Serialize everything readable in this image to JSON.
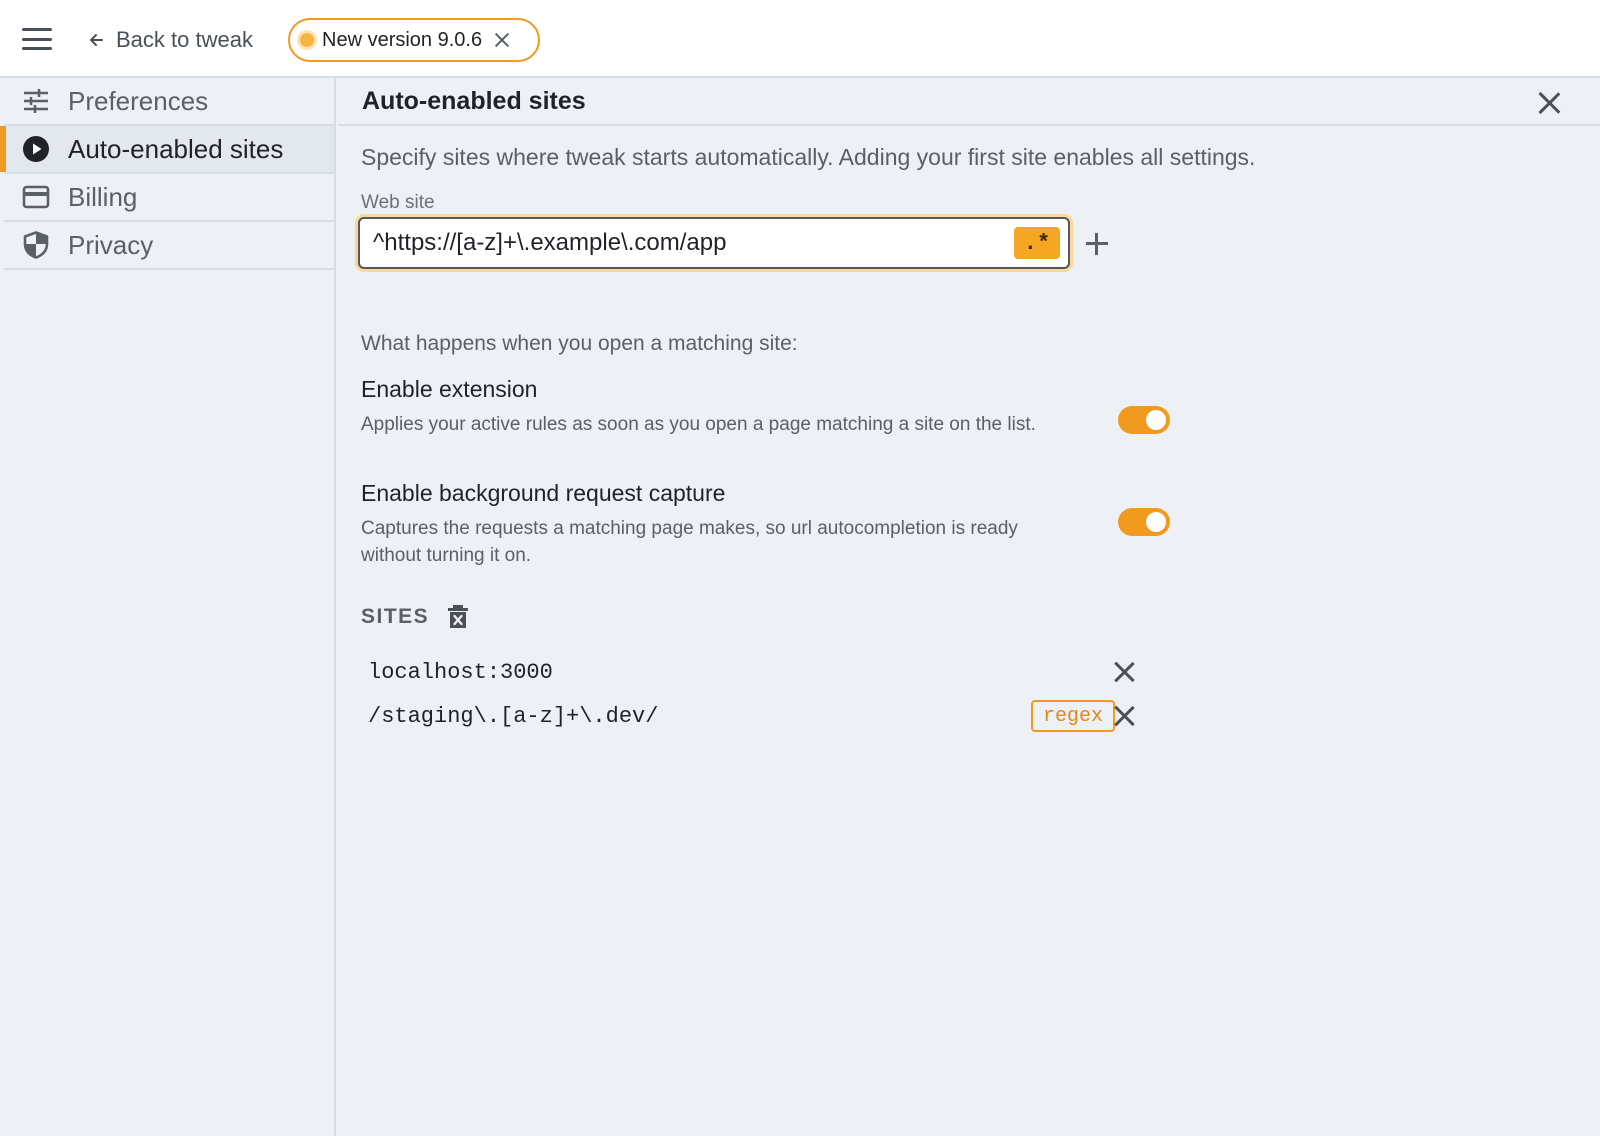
{
  "topbar": {
    "menu_icon": "hamburger-menu-icon",
    "back_label": "Back to tweak",
    "back_icon": "arrow-left-icon",
    "version_label": "New version 9.0.6",
    "version_dot_color": "#f8b441",
    "accent_color": "#f29a1f"
  },
  "sidebar": {
    "items": [
      {
        "label": "Preferences",
        "icon": "sliders-icon",
        "active": false
      },
      {
        "label": "Auto-enabled sites",
        "icon": "play-circle-icon",
        "active": true
      },
      {
        "label": "Billing",
        "icon": "credit-card-icon",
        "active": false
      },
      {
        "label": "Privacy",
        "icon": "shield-icon",
        "active": false
      }
    ]
  },
  "panel": {
    "title": "Auto-enabled sites",
    "description": "Specify sites where tweak starts automatically. Adding your first site enables all settings.",
    "web_site_label": "Web site",
    "web_site_value": "^https://[a-z]+\\.example\\.com/app",
    "regex_toggle_label": ".*",
    "question": "What happens when you open a matching site:",
    "settings": [
      {
        "title": "Enable extension",
        "description": "Applies your active rules as soon as you open a page matching a site on the list.",
        "enabled": true
      },
      {
        "title": "Enable background request capture",
        "description": "Captures the requests a matching page makes, so url autocompletion is ready without turning it on.",
        "enabled": true
      }
    ],
    "sites_heading": "SITES",
    "sites": [
      {
        "value": "localhost:3000",
        "regex": false
      },
      {
        "value": "/staging\\.[a-z]+\\.dev/",
        "regex": true,
        "badge": "regex"
      }
    ]
  }
}
